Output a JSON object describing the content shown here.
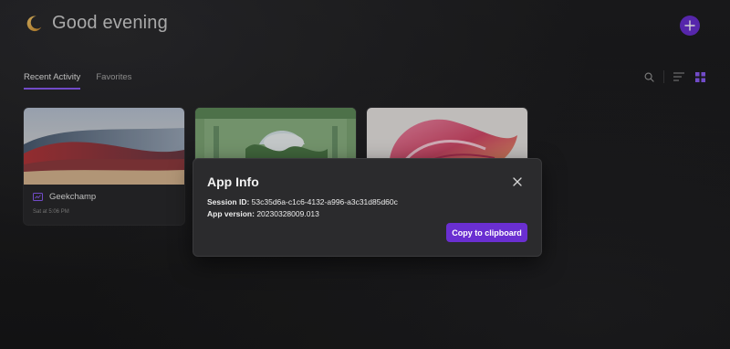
{
  "header": {
    "greeting": "Good evening"
  },
  "tabs": [
    {
      "label": "Recent Activity",
      "active": true
    },
    {
      "label": "Favorites",
      "active": false
    }
  ],
  "cards": [
    {
      "title": "Geekchamp",
      "time": "Sat at 5:06 PM",
      "icon": "whiteboard-icon"
    }
  ],
  "dialog": {
    "title": "App Info",
    "session_label": "Session ID:",
    "session_value": "53c35d6a-c1c6-4132-a996-a3c31d85d60c",
    "version_label": "App version:",
    "version_value": "20230328009.013",
    "copy_label": "Copy to clipboard"
  },
  "colors": {
    "accent": "#6a2fd1",
    "tab_underline": "#8a5cf5"
  }
}
